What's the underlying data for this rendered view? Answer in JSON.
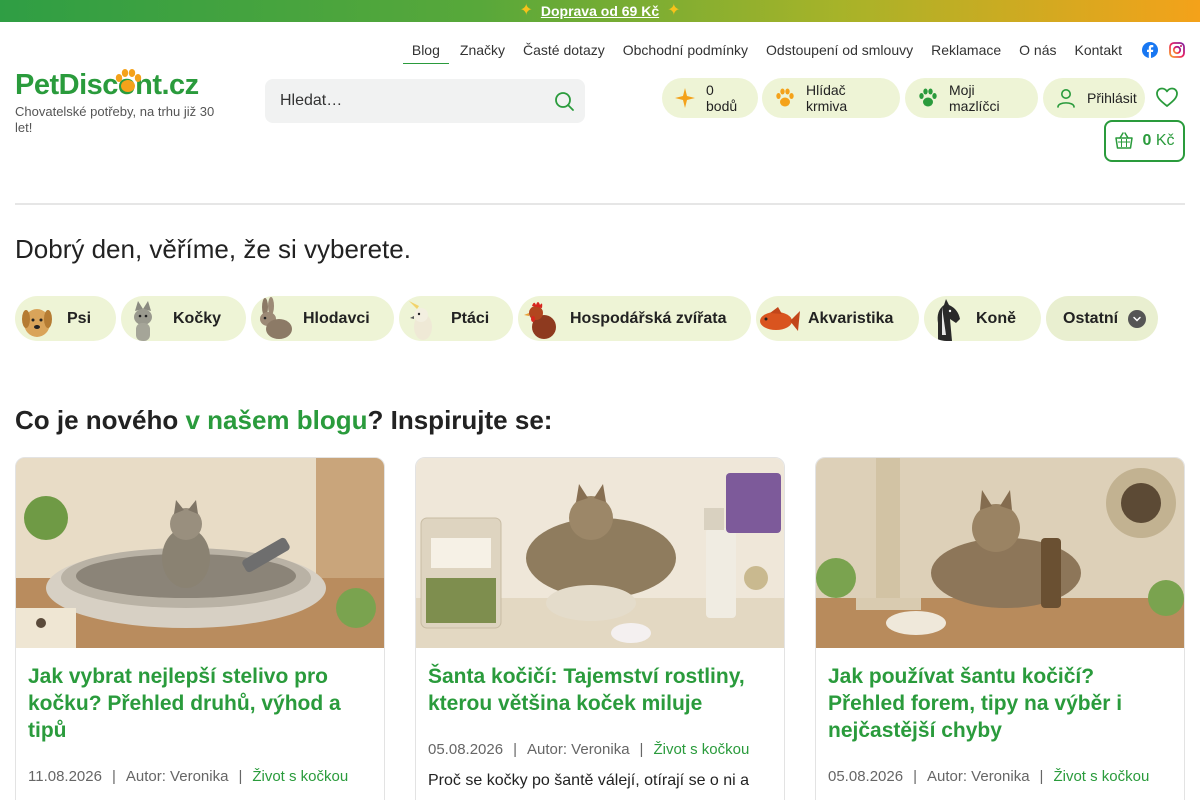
{
  "promo": {
    "text": "Doprava od 69 Kč"
  },
  "topnav": {
    "items": [
      "Blog",
      "Značky",
      "Časté dotazy",
      "Obchodní podmínky",
      "Odstoupení od smlouvy",
      "Reklamace",
      "O nás",
      "Kontakt"
    ],
    "active": "Blog"
  },
  "logo": {
    "text": "PetDiscont.cz",
    "tagline": "Chovatelské potřeby, na trhu již 30 let!"
  },
  "search": {
    "placeholder": "Hledat…"
  },
  "header": {
    "points": "0 bodů",
    "feed_watch": "Hlídač krmiva",
    "my_pets": "Moji mazlíčci",
    "login": "Přihlásit",
    "cart_amount": "0",
    "cart_currency": "Kč"
  },
  "greeting": "Dobrý den, věříme, že si vyberete.",
  "categories": [
    "Psi",
    "Kočky",
    "Hlodavci",
    "Ptáci",
    "Hospodářská zvířata",
    "Akvaristika",
    "Koně",
    "Ostatní"
  ],
  "blog": {
    "heading_pre": "Co je nového ",
    "heading_link": "v našem blogu",
    "heading_post": "? Inspirujte se:",
    "cards": [
      {
        "title": "Jak vybrat nejlepší stelivo pro kočku? Přehled druhů, výhod a tipů",
        "date": "11.08.2026",
        "author": "Autor: Veronika",
        "tag": "Život s kočkou",
        "excerpt": ""
      },
      {
        "title": "Šanta kočičí: Tajemství rostliny, kterou většina koček miluje",
        "date": "05.08.2026",
        "author": "Autor: Veronika",
        "tag": "Život s kočkou",
        "excerpt": "Proč se kočky po šantě válejí, otírají se o ni a"
      },
      {
        "title": "Jak používat šantu kočičí? Přehled forem, tipy na výběr i nejčastější chyby",
        "date": "05.08.2026",
        "author": "Autor: Veronika",
        "tag": "Život s kočkou",
        "excerpt": ""
      }
    ],
    "separator": "|"
  },
  "colors": {
    "brand_green": "#2a9b3c",
    "pill_bg": "#eef4d6",
    "accent_orange": "#f4a21a"
  }
}
